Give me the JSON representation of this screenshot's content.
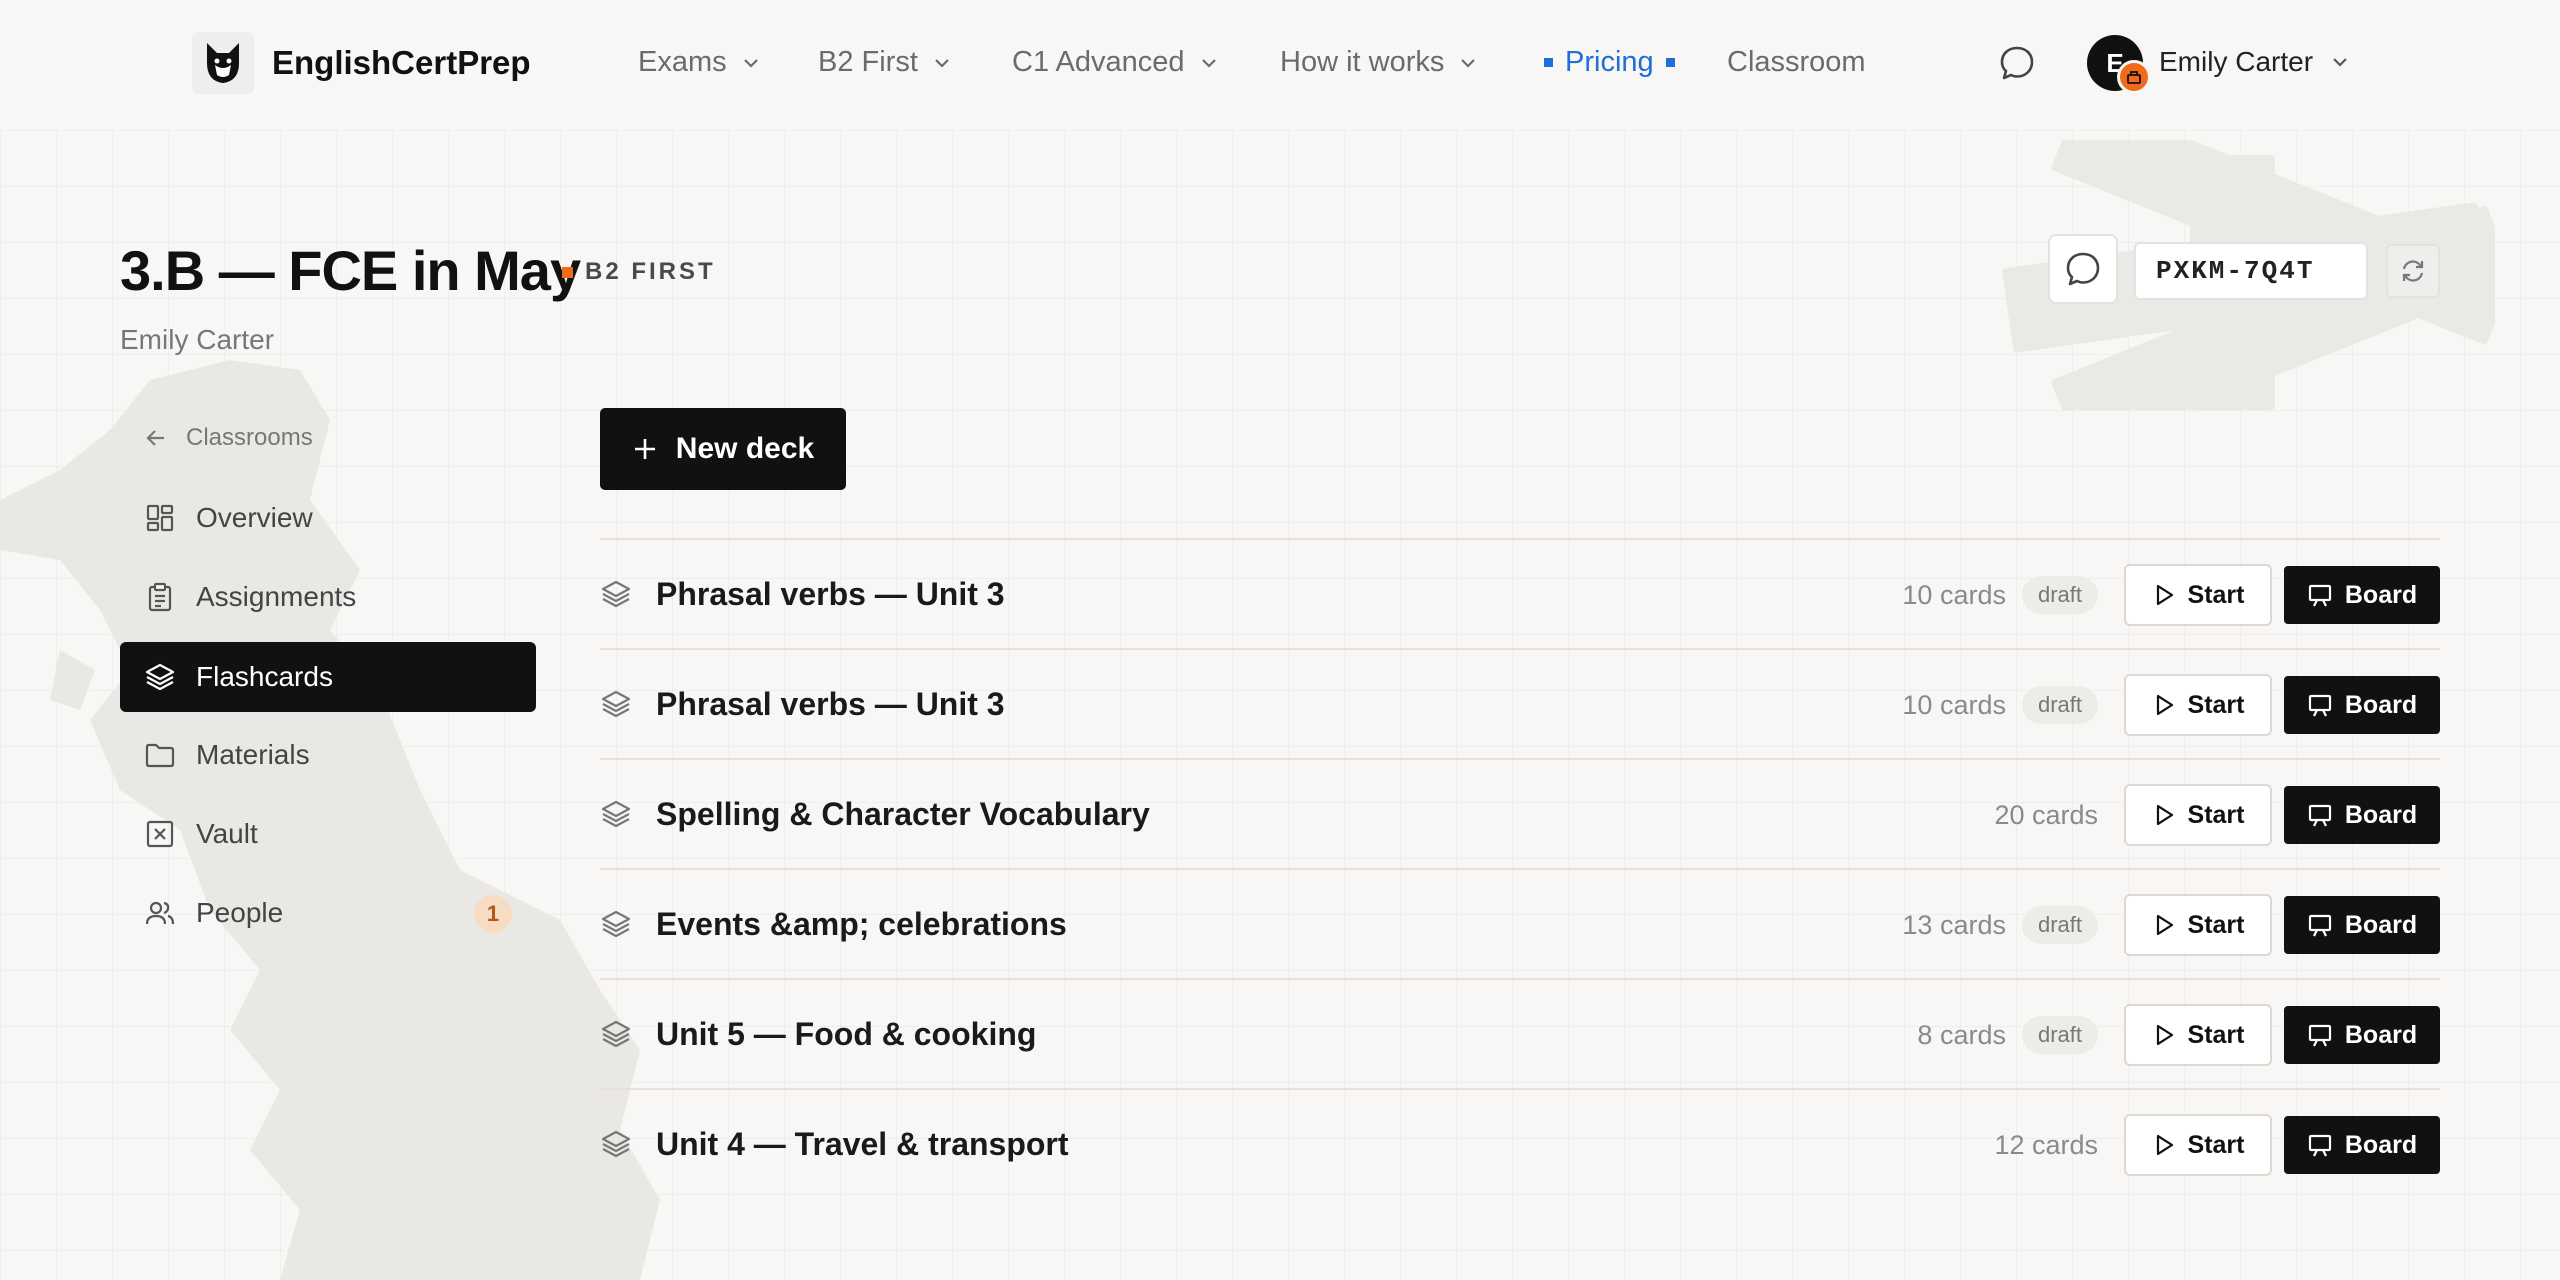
{
  "app": {
    "brand": "EnglishCertPrep"
  },
  "nav": {
    "exams": "Exams",
    "b2_first": "B2 First",
    "c1_advanced": "C1 Advanced",
    "how_it_works": "How it works",
    "pricing": "Pricing",
    "classroom": "Classroom",
    "user_initial": "E",
    "user_name": "Emily Carter"
  },
  "header": {
    "title": "3.B — FCE in May",
    "level": "B2 FIRST",
    "teacher": "Emily Carter",
    "join_code": "PXKM-7Q4T"
  },
  "sidebar": {
    "back": "Classrooms",
    "items": [
      {
        "label": "Overview",
        "icon": "grid-icon"
      },
      {
        "label": "Assignments",
        "icon": "clipboard-icon"
      },
      {
        "label": "Flashcards",
        "icon": "layers-icon",
        "active": true
      },
      {
        "label": "Materials",
        "icon": "folder-icon"
      },
      {
        "label": "Vault",
        "icon": "vault-icon"
      },
      {
        "label": "People",
        "icon": "people-icon",
        "count": "1"
      }
    ]
  },
  "main": {
    "new_deck": "New deck",
    "start_label": "Start",
    "board_label": "Board",
    "decks": [
      {
        "title": "Phrasal verbs — Unit 3",
        "cards": "10 cards",
        "status": "draft"
      },
      {
        "title": "Phrasal verbs — Unit 3",
        "cards": "10 cards",
        "status": "draft"
      },
      {
        "title": "Spelling & Character Vocabulary",
        "cards": "20 cards",
        "status": ""
      },
      {
        "title": "Events &amp; celebrations",
        "cards": "13 cards",
        "status": "draft"
      },
      {
        "title": "Unit 5 — Food & cooking",
        "cards": "8 cards",
        "status": "draft"
      },
      {
        "title": "Unit 4 — Travel & transport",
        "cards": "12 cards",
        "status": ""
      }
    ]
  },
  "colors": {
    "accent_orange": "#f06a1a",
    "link_blue": "#1e6fd9",
    "dark": "#111111"
  }
}
